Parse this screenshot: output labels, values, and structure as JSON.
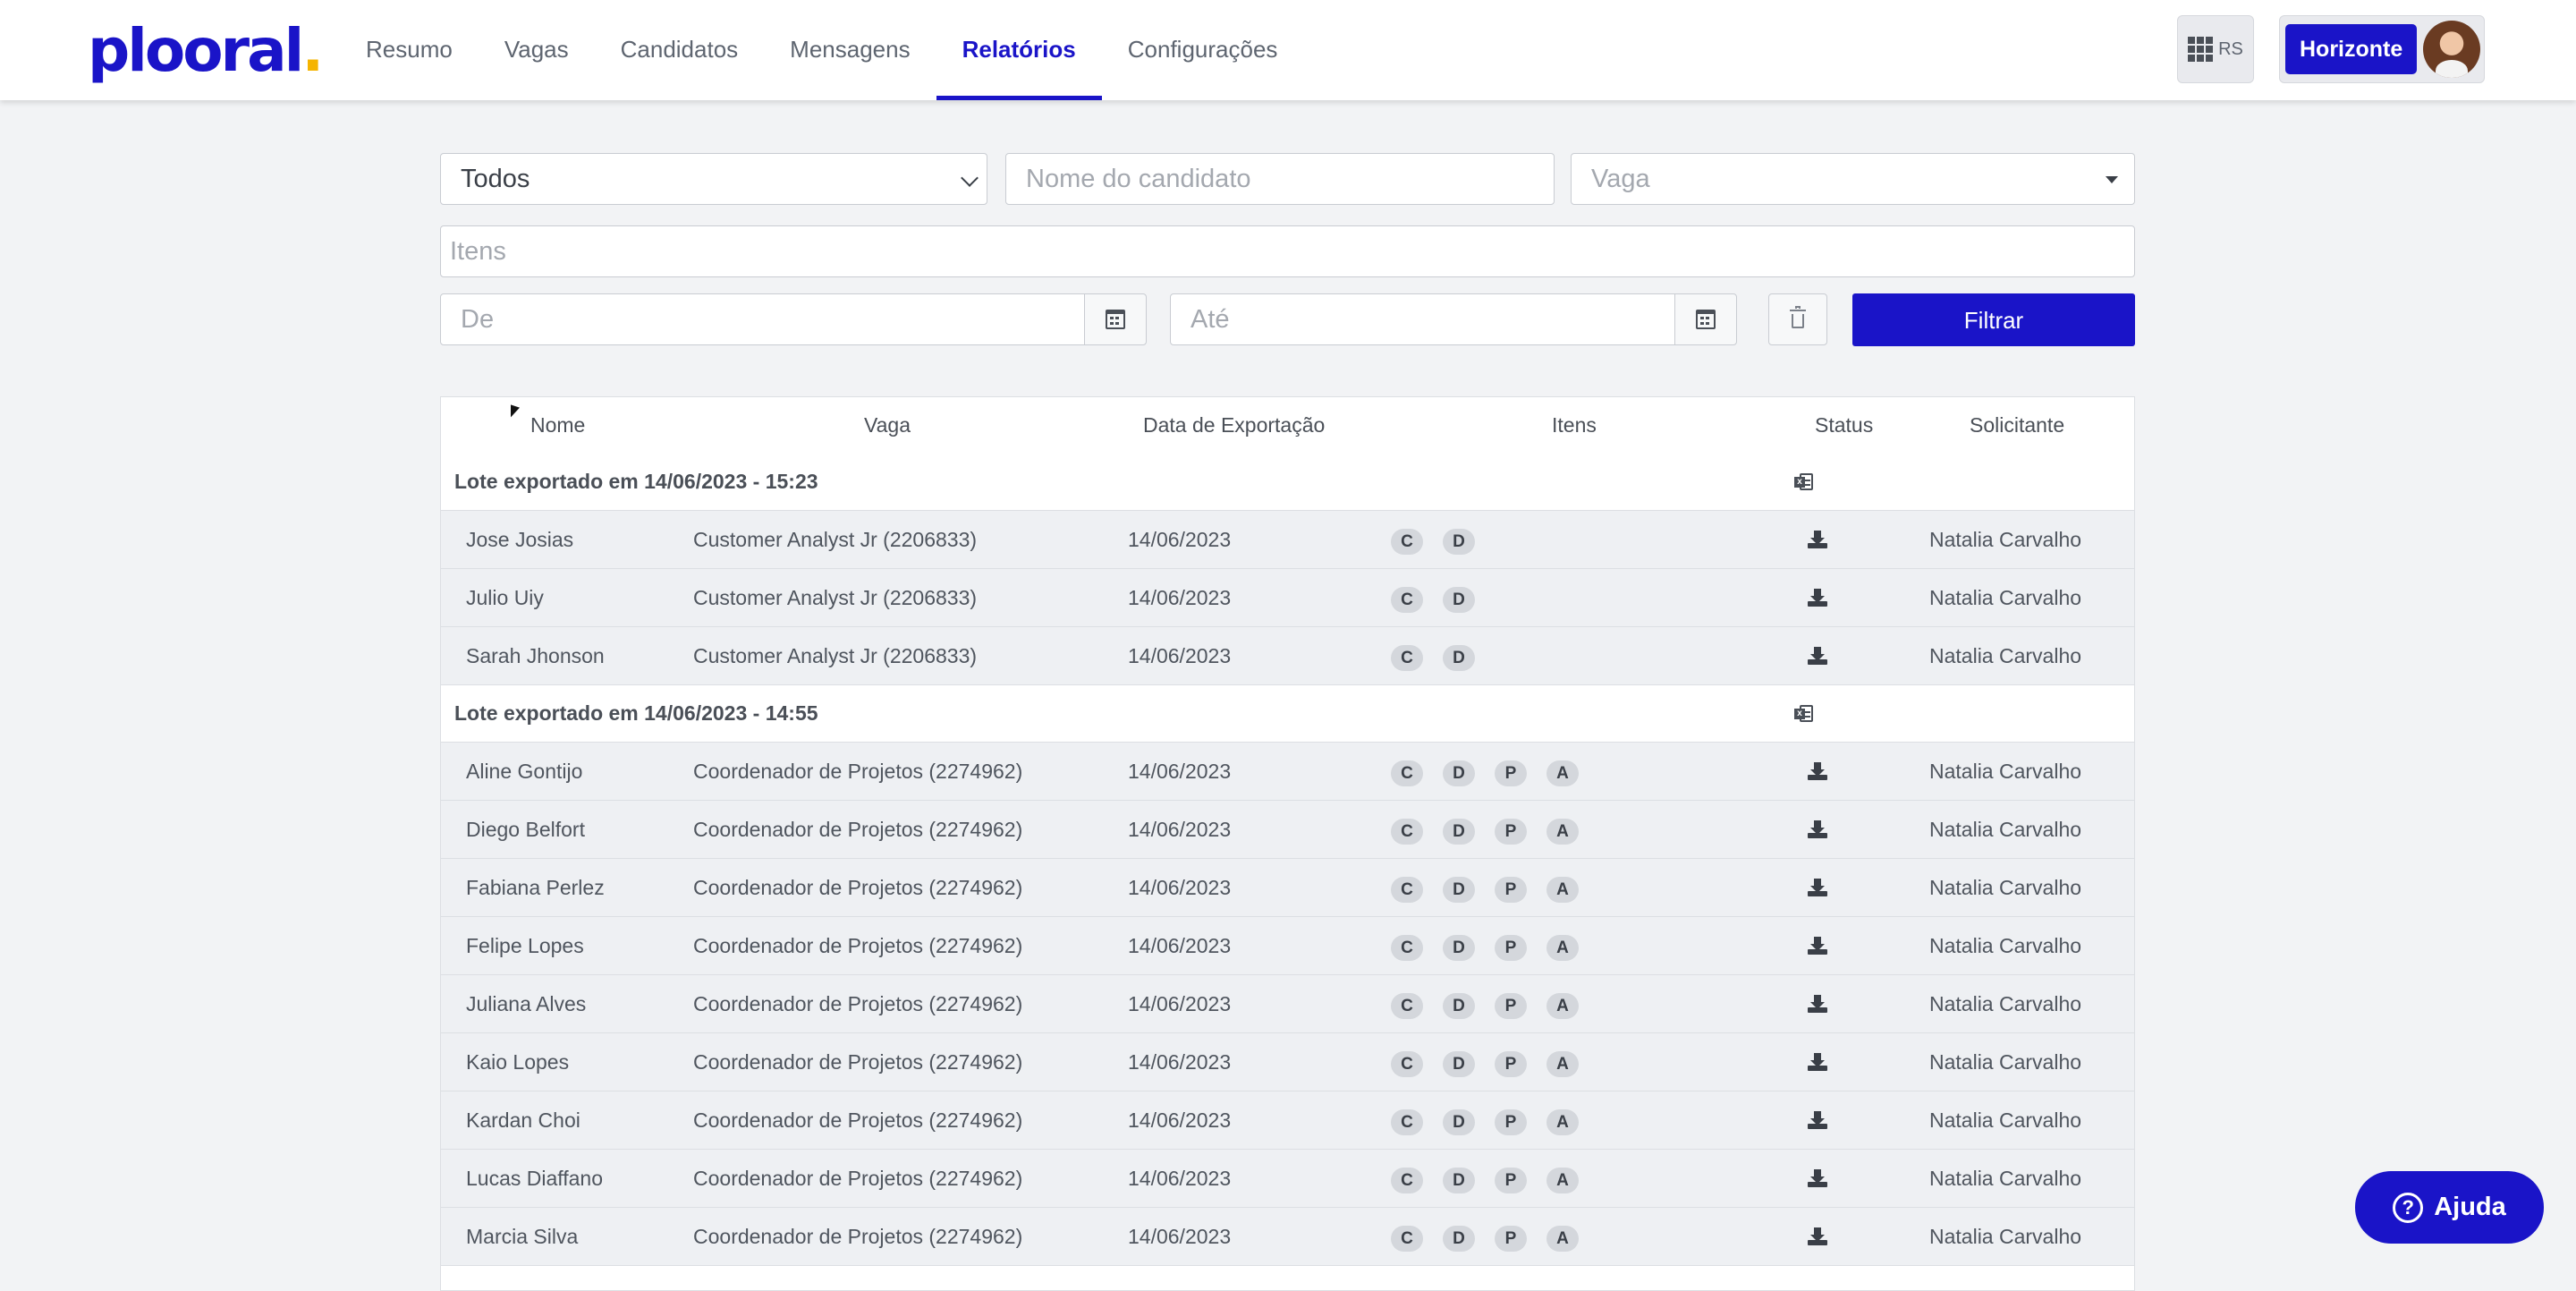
{
  "brand": {
    "logo_main": "plooral",
    "logo_dot": "."
  },
  "nav": {
    "items": [
      {
        "label": "Resumo",
        "active": false
      },
      {
        "label": "Vagas",
        "active": false
      },
      {
        "label": "Candidatos",
        "active": false
      },
      {
        "label": "Mensagens",
        "active": false
      },
      {
        "label": "Relatórios",
        "active": true
      },
      {
        "label": "Configurações",
        "active": false
      }
    ]
  },
  "header_right": {
    "apps_icon": "grid-icon",
    "apps_initials": "RS",
    "organization": "Horizonte",
    "avatar_icon": "user-avatar"
  },
  "filters": {
    "status_select": "Todos",
    "candidate_placeholder": "Nome do candidato",
    "job_placeholder": "Vaga",
    "items_placeholder": "Itens",
    "from_placeholder": "De",
    "to_placeholder": "Até",
    "filter_button": "Filtrar"
  },
  "table": {
    "headers": {
      "name": "Nome",
      "job": "Vaga",
      "export_date": "Data de Exportação",
      "items": "Itens",
      "status": "Status",
      "requester": "Solicitante"
    },
    "groups": [
      {
        "label": "Lote exportado em 14/06/2023 - 15:23",
        "icon": "excel-export-icon",
        "rows": [
          {
            "name": "Jose Josias",
            "job": "Customer Analyst Jr (2206833)",
            "date": "14/06/2023",
            "items": [
              "C",
              "D"
            ],
            "requester": "Natalia Carvalho"
          },
          {
            "name": "Julio Uiy",
            "job": "Customer Analyst Jr (2206833)",
            "date": "14/06/2023",
            "items": [
              "C",
              "D"
            ],
            "requester": "Natalia Carvalho"
          },
          {
            "name": "Sarah Jhonson",
            "job": "Customer Analyst Jr (2206833)",
            "date": "14/06/2023",
            "items": [
              "C",
              "D"
            ],
            "requester": "Natalia Carvalho"
          }
        ]
      },
      {
        "label": "Lote exportado em 14/06/2023 - 14:55",
        "icon": "excel-export-icon",
        "rows": [
          {
            "name": "Aline Gontijo",
            "job": "Coordenador de Projetos (2274962)",
            "date": "14/06/2023",
            "items": [
              "C",
              "D",
              "P",
              "A"
            ],
            "requester": "Natalia Carvalho"
          },
          {
            "name": "Diego Belfort",
            "job": "Coordenador de Projetos (2274962)",
            "date": "14/06/2023",
            "items": [
              "C",
              "D",
              "P",
              "A"
            ],
            "requester": "Natalia Carvalho"
          },
          {
            "name": "Fabiana Perlez",
            "job": "Coordenador de Projetos (2274962)",
            "date": "14/06/2023",
            "items": [
              "C",
              "D",
              "P",
              "A"
            ],
            "requester": "Natalia Carvalho"
          },
          {
            "name": "Felipe Lopes",
            "job": "Coordenador de Projetos (2274962)",
            "date": "14/06/2023",
            "items": [
              "C",
              "D",
              "P",
              "A"
            ],
            "requester": "Natalia Carvalho"
          },
          {
            "name": "Juliana Alves",
            "job": "Coordenador de Projetos (2274962)",
            "date": "14/06/2023",
            "items": [
              "C",
              "D",
              "P",
              "A"
            ],
            "requester": "Natalia Carvalho"
          },
          {
            "name": "Kaio Lopes",
            "job": "Coordenador de Projetos (2274962)",
            "date": "14/06/2023",
            "items": [
              "C",
              "D",
              "P",
              "A"
            ],
            "requester": "Natalia Carvalho"
          },
          {
            "name": "Kardan Choi",
            "job": "Coordenador de Projetos (2274962)",
            "date": "14/06/2023",
            "items": [
              "C",
              "D",
              "P",
              "A"
            ],
            "requester": "Natalia Carvalho"
          },
          {
            "name": "Lucas Diaffano",
            "job": "Coordenador de Projetos (2274962)",
            "date": "14/06/2023",
            "items": [
              "C",
              "D",
              "P",
              "A"
            ],
            "requester": "Natalia Carvalho"
          },
          {
            "name": "Marcia Silva",
            "job": "Coordenador de Projetos (2274962)",
            "date": "14/06/2023",
            "items": [
              "C",
              "D",
              "P",
              "A"
            ],
            "requester": "Natalia Carvalho"
          }
        ]
      }
    ]
  },
  "help": {
    "label": "Ajuda",
    "icon": "question-icon"
  },
  "colors": {
    "accent": "#1a14c8",
    "logo_dot": "#f5b400",
    "background": "#f2f3f5",
    "row_bg": "#eef0f3"
  }
}
